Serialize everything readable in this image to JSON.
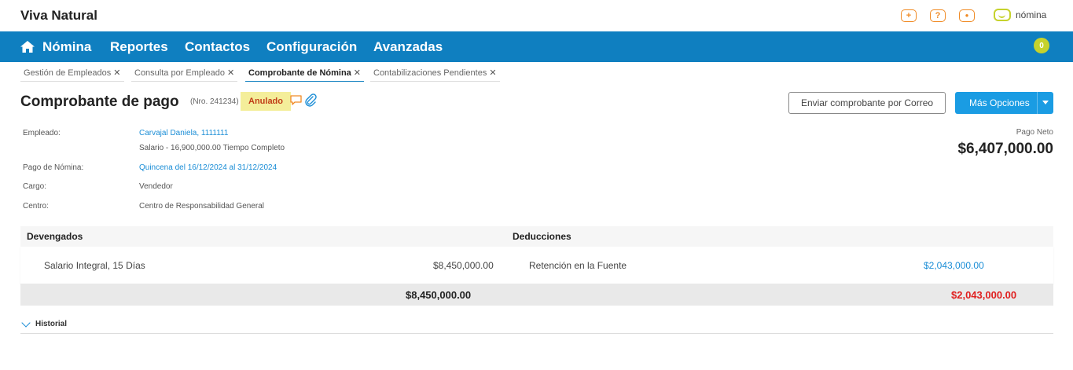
{
  "app": {
    "title": "Viva Natural",
    "brand": "nómina"
  },
  "top_icons": [
    {
      "name": "add-icon",
      "glyph": "+"
    },
    {
      "name": "help-icon",
      "glyph": "?"
    },
    {
      "name": "user-icon",
      "glyph": "●"
    }
  ],
  "nav": {
    "items": [
      "Nómina",
      "Reportes",
      "Contactos",
      "Configuración",
      "Avanzadas"
    ],
    "badge": "0"
  },
  "tabs": [
    {
      "label": "Gestión de Empleados",
      "active": false
    },
    {
      "label": "Consulta por Empleado",
      "active": false
    },
    {
      "label": "Comprobante de Nómina",
      "active": true
    },
    {
      "label": "Contabilizaciones Pendientes",
      "active": false
    }
  ],
  "header": {
    "title": "Comprobante de pago",
    "nro": "(Nro. 241234)",
    "status": "Anulado",
    "email_button": "Enviar comprobante por Correo",
    "more_button": "Más Opciones"
  },
  "info": {
    "empleado_label": "Empleado:",
    "empleado_value": "Carvajal Daniela, 1111111",
    "salario_value": "Salario - 16,900,000.00 Tiempo Completo",
    "pago_label": "Pago de Nómina:",
    "pago_value": "Quincena del 16/12/2024 al 31/12/2024",
    "cargo_label": "Cargo:",
    "cargo_value": "Vendedor",
    "centro_label": "Centro:",
    "centro_value": "Centro de Responsabilidad General"
  },
  "pago_neto": {
    "label": "Pago Neto",
    "value": "$6,407,000.00"
  },
  "table": {
    "devengados_header": "Devengados",
    "deducciones_header": "Deducciones",
    "row": {
      "devengado_concept": "Salario Integral, 15 Días",
      "devengado_amount": "$8,450,000.00",
      "deduccion_concept": "Retención en la Fuente",
      "deduccion_amount": "$2,043,000.00"
    },
    "total_devengados": "$8,450,000.00",
    "total_deducciones": "$2,043,000.00"
  },
  "historial": {
    "label": "Historial"
  },
  "colors": {
    "primary": "#0f7fc0",
    "accent": "#f08a24",
    "lime": "#c6d22c",
    "button": "#1a9ce3",
    "negative": "#e01f1f",
    "link": "#1a8dd6"
  }
}
